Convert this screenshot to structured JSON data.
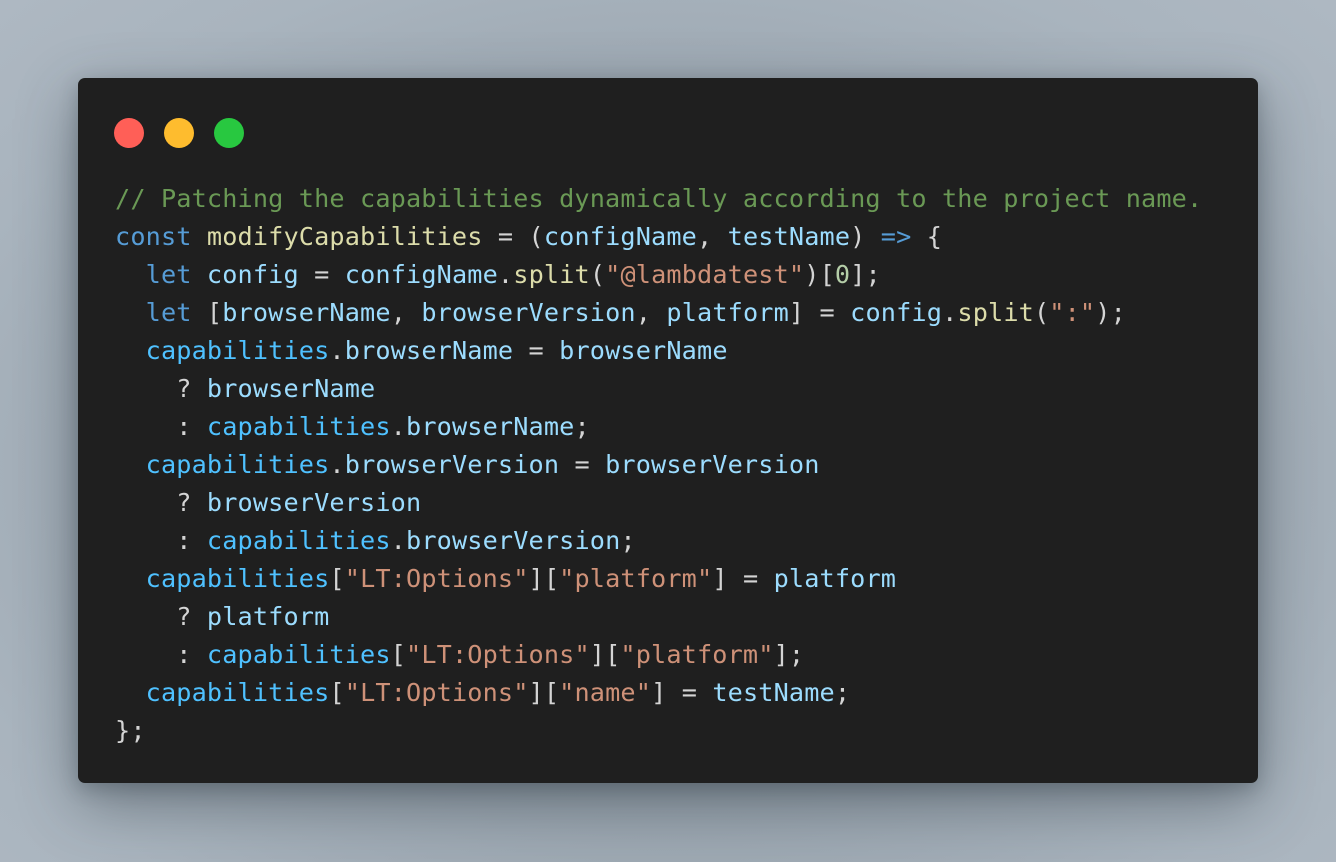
{
  "window": {
    "background": "#1f1f1f",
    "controls": [
      {
        "name": "close",
        "color": "#ff5f57"
      },
      {
        "name": "minimize",
        "color": "#febc2e"
      },
      {
        "name": "maximize",
        "color": "#28c840"
      }
    ]
  },
  "theme": {
    "comment": "#6a9955",
    "keyword": "#569cd6",
    "function": "#dcdcaa",
    "variable": "#9cdcfe",
    "object": "#4fc1ff",
    "string": "#ce9178",
    "number": "#b5cea8",
    "punctuation": "#d4d4d4"
  },
  "code": {
    "language": "javascript",
    "lines": [
      [
        [
          "comment",
          "// Patching the capabilities dynamically according to the project name."
        ]
      ],
      [
        [
          "keyword",
          "const"
        ],
        [
          "punct",
          " "
        ],
        [
          "function",
          "modifyCapabilities"
        ],
        [
          "punct",
          " = ("
        ],
        [
          "variable",
          "configName"
        ],
        [
          "punct",
          ", "
        ],
        [
          "variable",
          "testName"
        ],
        [
          "punct",
          ") "
        ],
        [
          "arrow",
          "=>"
        ],
        [
          "punct",
          " {"
        ]
      ],
      [
        [
          "punct",
          "  "
        ],
        [
          "keyword",
          "let"
        ],
        [
          "punct",
          " "
        ],
        [
          "variable",
          "config"
        ],
        [
          "punct",
          " = "
        ],
        [
          "variable",
          "configName"
        ],
        [
          "punct",
          "."
        ],
        [
          "function",
          "split"
        ],
        [
          "punct",
          "("
        ],
        [
          "string",
          "\"@lambdatest\""
        ],
        [
          "punct",
          ")["
        ],
        [
          "number",
          "0"
        ],
        [
          "punct",
          "];"
        ]
      ],
      [
        [
          "punct",
          "  "
        ],
        [
          "keyword",
          "let"
        ],
        [
          "punct",
          " ["
        ],
        [
          "variable",
          "browserName"
        ],
        [
          "punct",
          ", "
        ],
        [
          "variable",
          "browserVersion"
        ],
        [
          "punct",
          ", "
        ],
        [
          "variable",
          "platform"
        ],
        [
          "punct",
          "] = "
        ],
        [
          "variable",
          "config"
        ],
        [
          "punct",
          "."
        ],
        [
          "function",
          "split"
        ],
        [
          "punct",
          "("
        ],
        [
          "string",
          "\":\""
        ],
        [
          "punct",
          ");"
        ]
      ],
      [
        [
          "punct",
          "  "
        ],
        [
          "object",
          "capabilities"
        ],
        [
          "punct",
          "."
        ],
        [
          "variable",
          "browserName"
        ],
        [
          "punct",
          " = "
        ],
        [
          "variable",
          "browserName"
        ]
      ],
      [
        [
          "punct",
          "    ? "
        ],
        [
          "variable",
          "browserName"
        ]
      ],
      [
        [
          "punct",
          "    : "
        ],
        [
          "object",
          "capabilities"
        ],
        [
          "punct",
          "."
        ],
        [
          "variable",
          "browserName"
        ],
        [
          "punct",
          ";"
        ]
      ],
      [
        [
          "punct",
          "  "
        ],
        [
          "object",
          "capabilities"
        ],
        [
          "punct",
          "."
        ],
        [
          "variable",
          "browserVersion"
        ],
        [
          "punct",
          " = "
        ],
        [
          "variable",
          "browserVersion"
        ]
      ],
      [
        [
          "punct",
          "    ? "
        ],
        [
          "variable",
          "browserVersion"
        ]
      ],
      [
        [
          "punct",
          "    : "
        ],
        [
          "object",
          "capabilities"
        ],
        [
          "punct",
          "."
        ],
        [
          "variable",
          "browserVersion"
        ],
        [
          "punct",
          ";"
        ]
      ],
      [
        [
          "punct",
          "  "
        ],
        [
          "object",
          "capabilities"
        ],
        [
          "punct",
          "["
        ],
        [
          "string",
          "\"LT:Options\""
        ],
        [
          "punct",
          "]["
        ],
        [
          "string",
          "\"platform\""
        ],
        [
          "punct",
          "] = "
        ],
        [
          "variable",
          "platform"
        ]
      ],
      [
        [
          "punct",
          "    ? "
        ],
        [
          "variable",
          "platform"
        ]
      ],
      [
        [
          "punct",
          "    : "
        ],
        [
          "object",
          "capabilities"
        ],
        [
          "punct",
          "["
        ],
        [
          "string",
          "\"LT:Options\""
        ],
        [
          "punct",
          "]["
        ],
        [
          "string",
          "\"platform\""
        ],
        [
          "punct",
          "];"
        ]
      ],
      [
        [
          "punct",
          "  "
        ],
        [
          "object",
          "capabilities"
        ],
        [
          "punct",
          "["
        ],
        [
          "string",
          "\"LT:Options\""
        ],
        [
          "punct",
          "]["
        ],
        [
          "string",
          "\"name\""
        ],
        [
          "punct",
          "] = "
        ],
        [
          "variable",
          "testName"
        ],
        [
          "punct",
          ";"
        ]
      ],
      [
        [
          "punct",
          "};"
        ]
      ]
    ]
  }
}
